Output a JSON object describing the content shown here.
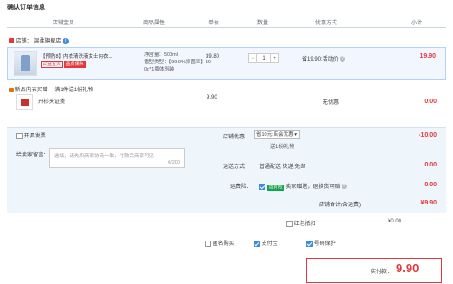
{
  "page": {
    "title": "确认订单信息"
  },
  "columns": [
    "店铺宝贝",
    "商品属性",
    "单价",
    "数量",
    "优惠方式",
    "小计"
  ],
  "shop": {
    "prefix": "店铺：",
    "name": "温柔旗舰店"
  },
  "item": {
    "name": "【预防8】内衣清洗液女士内衣...",
    "tag1": "公益宝贝",
    "tag2": "品质保障",
    "spec_lines": [
      "净含量：500ml",
      "香型类型：【99.9%抑菌率】50",
      "0g*1瓶体验装"
    ],
    "price": "39.80",
    "qty": "1",
    "minus": "−",
    "plus": "+",
    "promo": "省19.90:活动价",
    "subtotal": "19.90"
  },
  "gift": {
    "title_label": "新品内衣买赠",
    "title_note": "满1件送1份礼物",
    "name": "开衫夹证类",
    "price": "9.90",
    "note": "无优惠",
    "subtotal": "0.00"
  },
  "panel": {
    "invoice_label": "开具发票",
    "message_label": "给卖家留言：",
    "message_placeholder": "选填，请先和商家协商一致，付款后商家可见",
    "message_count": "0/200",
    "shop_discount_label": "店铺优惠：",
    "shop_discount_select": "省10元:店会优惠",
    "shop_discount_note": "送1份礼物",
    "shop_discount_value": "-10.00",
    "delivery_label": "运送方式：",
    "delivery_value": "普通配送 快递 免邮",
    "delivery_amount": "0.00",
    "insurance_label": "运费险：",
    "insurance_tag": "运费险",
    "insurance_value": "卖家赠送，退换货可赔",
    "insurance_amount": "0.00",
    "shop_total_label": "店铺合计(含运费)",
    "shop_total_value": "¥9.90"
  },
  "footer": {
    "redpacket_label": "红包抵扣",
    "redpacket_value": "¥0.00"
  },
  "options": {
    "anonymous": "匿名购买",
    "alipay": "支付宝",
    "protect": "号码保护"
  },
  "pay": {
    "label": "实付款：",
    "amount": "9.90"
  }
}
